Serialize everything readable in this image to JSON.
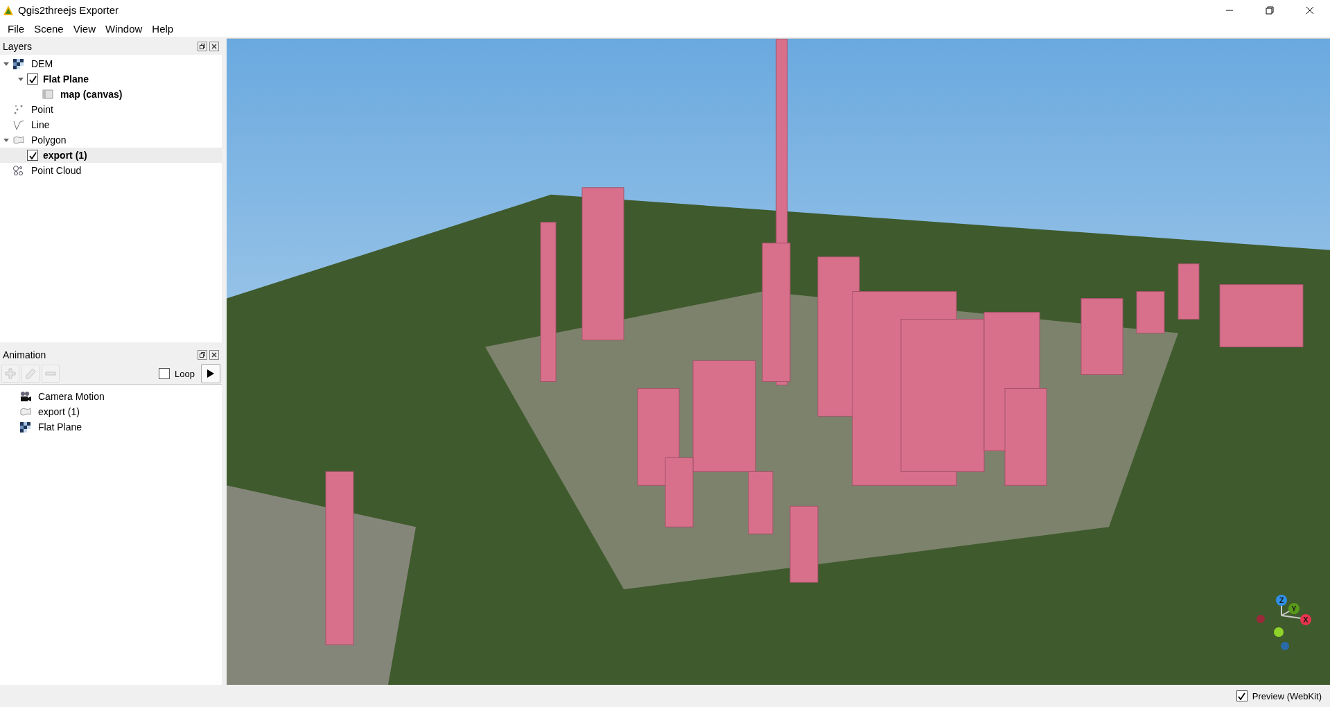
{
  "window": {
    "title": "Qgis2threejs Exporter"
  },
  "menu": [
    "File",
    "Scene",
    "View",
    "Window",
    "Help"
  ],
  "layers_panel": {
    "title": "Layers",
    "items": [
      {
        "label": "DEM",
        "kind": "dem",
        "expanded": true,
        "selected": false,
        "children": [
          {
            "label": "Flat Plane",
            "kind": "layer",
            "checked": true,
            "expanded": true,
            "selected": false,
            "children": [
              {
                "label": "map (canvas)",
                "kind": "material",
                "selected": false
              }
            ]
          }
        ]
      },
      {
        "label": "Point",
        "kind": "point",
        "selected": false
      },
      {
        "label": "Line",
        "kind": "line",
        "selected": false
      },
      {
        "label": "Polygon",
        "kind": "polygon",
        "expanded": true,
        "selected": false,
        "children": [
          {
            "label": "export (1)",
            "kind": "layer",
            "checked": true,
            "selected": true
          }
        ]
      },
      {
        "label": "Point Cloud",
        "kind": "pointcloud",
        "selected": false
      }
    ]
  },
  "animation_panel": {
    "title": "Animation",
    "tools": [
      {
        "kind": "add",
        "disabled": true
      },
      {
        "kind": "edit",
        "disabled": true
      },
      {
        "kind": "remove",
        "disabled": true
      }
    ],
    "loop": {
      "label": "Loop",
      "checked": false
    },
    "items": [
      {
        "label": "Camera Motion",
        "kind": "camera"
      },
      {
        "label": "export (1)",
        "kind": "polygon"
      },
      {
        "label": "Flat Plane",
        "kind": "dem"
      }
    ]
  },
  "viewport": {
    "axes": [
      {
        "label": "Z",
        "color": "#2f8fe8"
      },
      {
        "label": "Y",
        "color": "#5a9a1a"
      },
      {
        "label": "X",
        "color": "#e8344e"
      }
    ]
  },
  "status_bar": {
    "preview": {
      "label": "Preview (WebKit)",
      "checked": true
    }
  }
}
